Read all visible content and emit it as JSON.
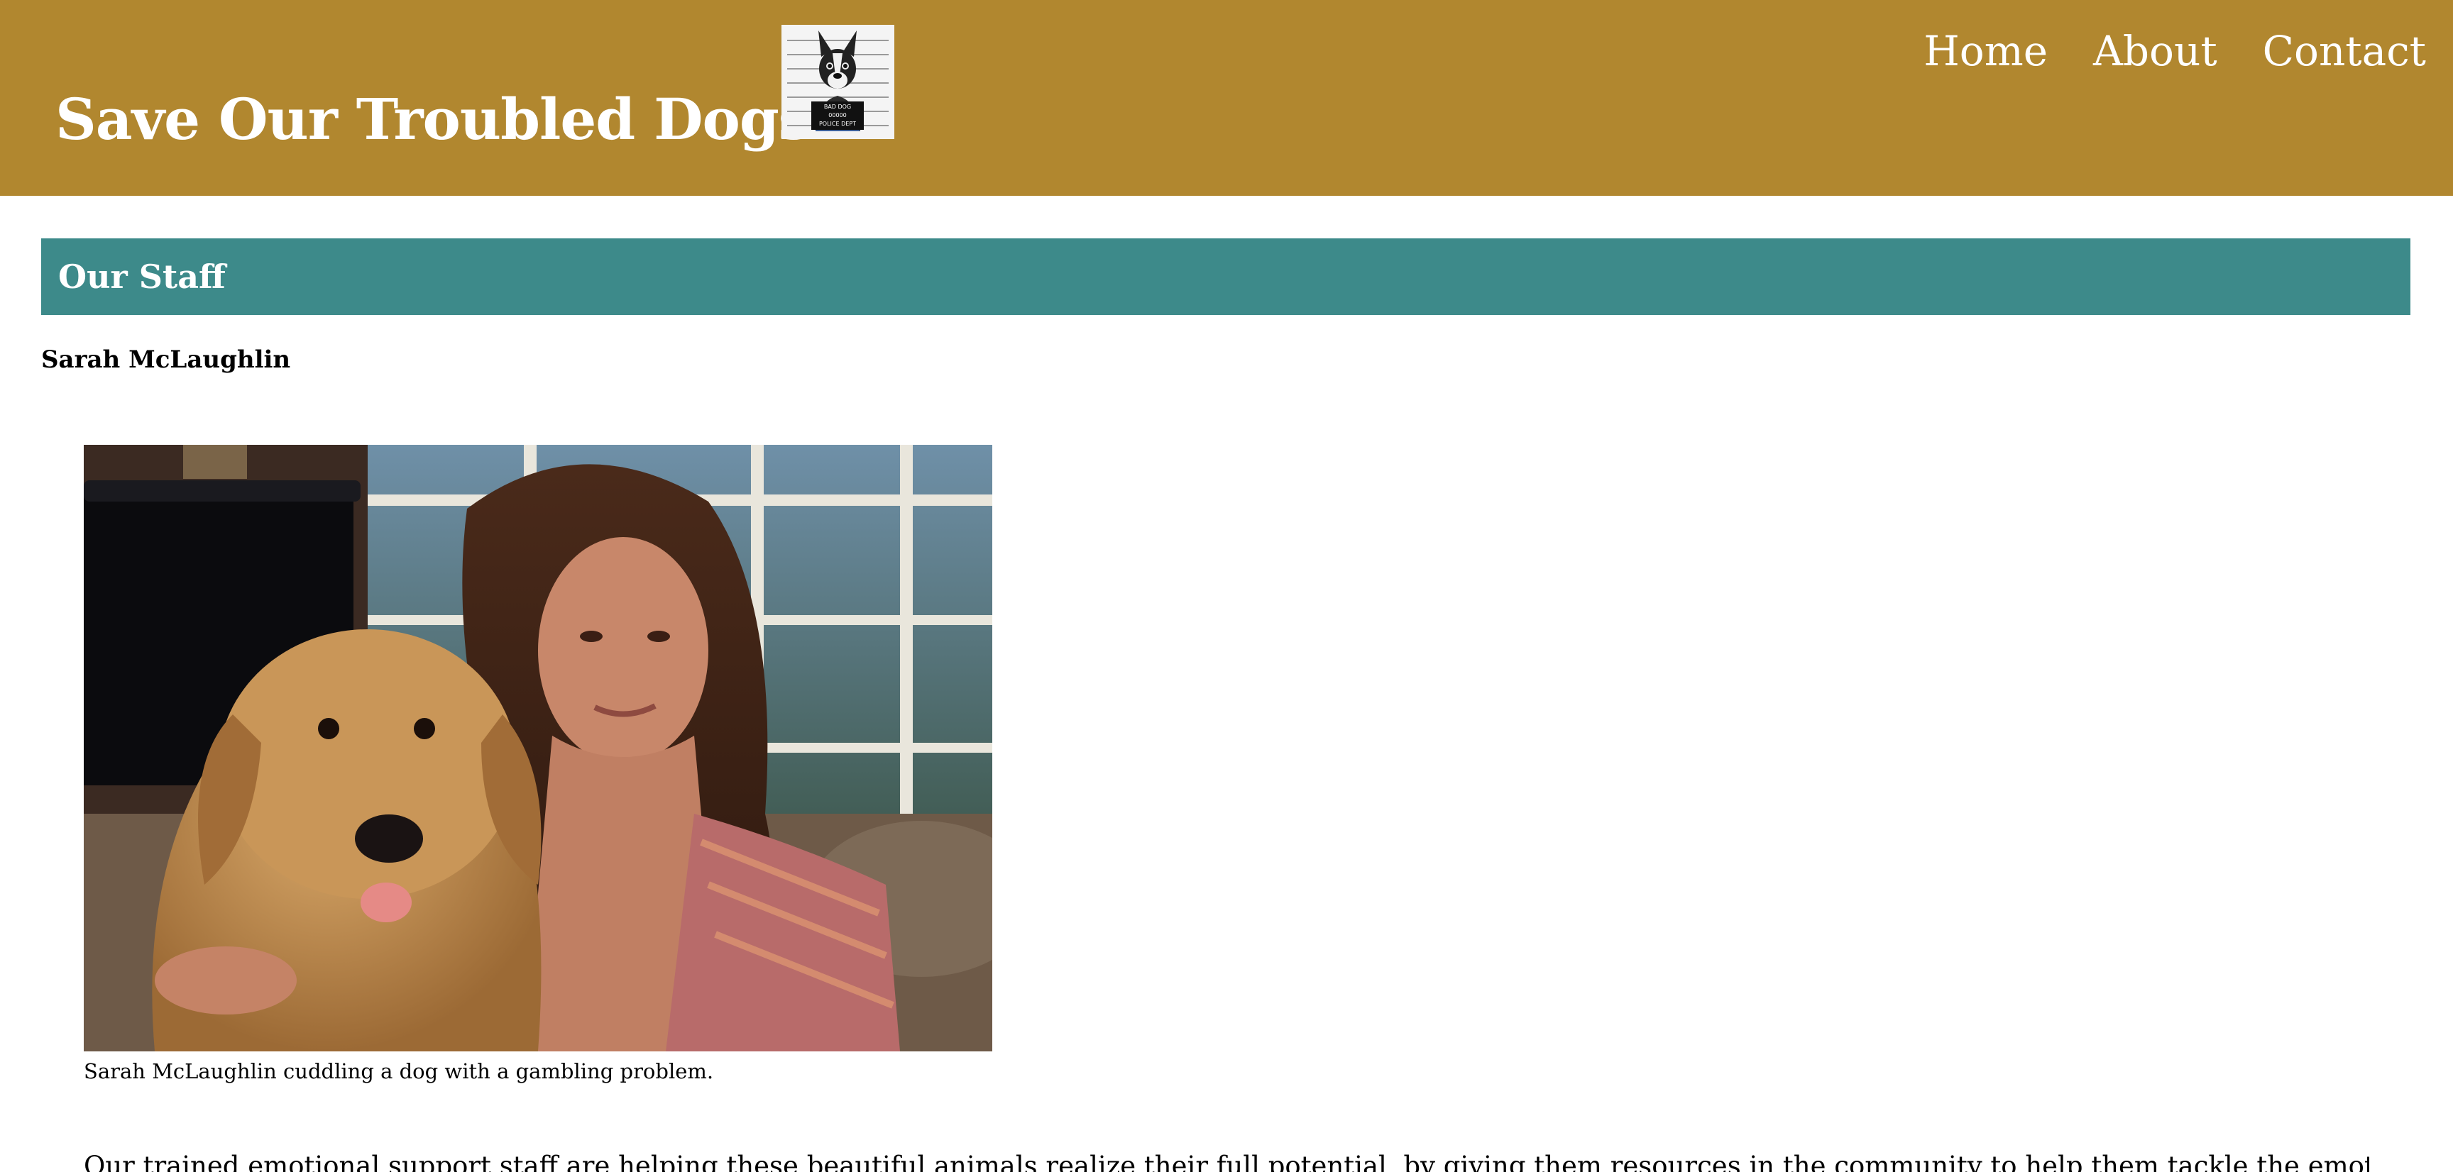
{
  "header": {
    "site_title": "Save Our Troubled Dogs",
    "logo_icon": "mugshot-dog-icon",
    "logo_sign_lines": [
      "BAD DOG",
      "00000",
      "POLICE DEPT"
    ],
    "background_color": "#b1872f"
  },
  "nav": {
    "items": [
      {
        "label": "Home"
      },
      {
        "label": "About"
      },
      {
        "label": "Contact"
      }
    ]
  },
  "main": {
    "section_title": "Our Staff",
    "section_color": "#3d8a8a",
    "staff": [
      {
        "name": "Sarah McLaughlin",
        "photo": "woman-with-golden-retriever-photo",
        "caption": "Sarah McLaughlin cuddling a dog with a gambling problem."
      }
    ],
    "intro_text": "Our trained emotional support staff are helping these beautiful animals realize their full potential, by giving them resources in the community to help them tackle the emotions, financial woes, and"
  }
}
